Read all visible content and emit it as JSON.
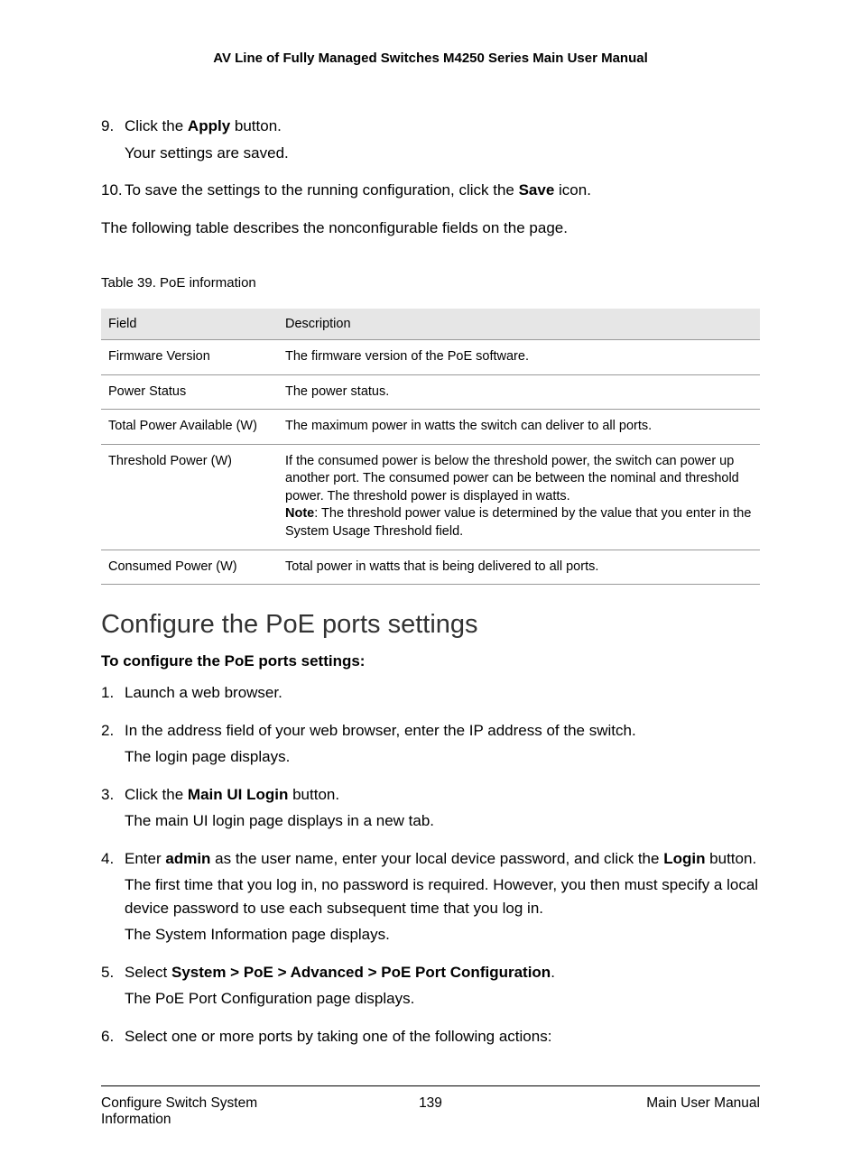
{
  "header": {
    "title": "AV Line of Fully Managed Switches M4250 Series Main User Manual"
  },
  "top_steps": [
    {
      "num": "9.",
      "lines": [
        {
          "pre": "Click the ",
          "bold": "Apply",
          "post": " button."
        },
        {
          "text": "Your settings are saved."
        }
      ]
    },
    {
      "num": "10.",
      "lines": [
        {
          "pre": "To save the settings to the running configuration, click the ",
          "bold": "Save",
          "post": " icon."
        }
      ]
    }
  ],
  "para_after": "The following table describes the nonconfigurable fields on the page.",
  "table": {
    "caption": "Table 39. PoE information",
    "headers": [
      "Field",
      "Description"
    ],
    "rows": [
      {
        "field": "Firmware Version",
        "desc": "The firmware version of the PoE software."
      },
      {
        "field": "Power Status",
        "desc": "The power status."
      },
      {
        "field": "Total Power Available (W)",
        "desc": "The maximum power in watts the switch can deliver to all ports."
      },
      {
        "field": "Threshold Power (W)",
        "desc_pre": "If the consumed power is below the threshold power, the switch can power up another port. The consumed power can be between the nominal and threshold power. The threshold power is displayed in watts.\n",
        "desc_bold": "Note",
        "desc_post": ": The threshold power value is determined by the value that you enter in the System Usage Threshold field."
      },
      {
        "field": "Consumed Power (W)",
        "desc": "Total power in watts that is being delivered to all ports."
      }
    ]
  },
  "section": {
    "heading": "Configure the PoE ports settings",
    "sub": "To configure the PoE ports settings:",
    "steps": [
      {
        "num": "1.",
        "lines": [
          {
            "text": "Launch a web browser."
          }
        ]
      },
      {
        "num": "2.",
        "lines": [
          {
            "text": "In the address field of your web browser, enter the IP address of the switch."
          },
          {
            "text": "The login page displays."
          }
        ]
      },
      {
        "num": "3.",
        "lines": [
          {
            "pre": "Click the ",
            "bold": "Main UI Login",
            "post": " button."
          },
          {
            "text": "The main UI login page displays in a new tab."
          }
        ]
      },
      {
        "num": "4.",
        "lines": [
          {
            "pre": "Enter ",
            "bold": "admin",
            "post": " as the user name, enter your local device password, and click the ",
            "bold2": "Login",
            "post2": " button."
          },
          {
            "text": "The first time that you log in, no password is required. However, you then must specify a local device password to use each subsequent time that you log in."
          },
          {
            "text": "The System Information page displays."
          }
        ]
      },
      {
        "num": "5.",
        "lines": [
          {
            "pre": "Select ",
            "bold": "System > PoE > Advanced > PoE Port Configuration",
            "post": "."
          },
          {
            "text": "The PoE Port Configuration page displays."
          }
        ]
      },
      {
        "num": "6.",
        "lines": [
          {
            "text": "Select one or more ports by taking one of the following actions:"
          }
        ]
      }
    ]
  },
  "footer": {
    "left": "Configure Switch System Information",
    "center": "139",
    "right": "Main User Manual"
  }
}
